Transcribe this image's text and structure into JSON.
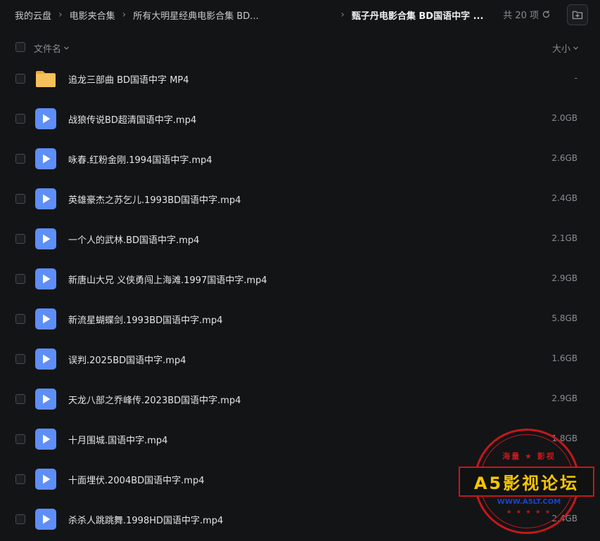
{
  "breadcrumb": {
    "items": [
      "我的云盘",
      "电影夹合集",
      "所有大明星经典电影合集 BD..."
    ],
    "current": "甄子丹电影合集 BD国语中字 ..."
  },
  "count_label": "共 20 项",
  "columns": {
    "name": "文件名",
    "size": "大小"
  },
  "files": [
    {
      "type": "folder",
      "name": "追龙三部曲 BD国语中字 MP4",
      "size": "-"
    },
    {
      "type": "video",
      "name": "战狼传说BD超清国语中字.mp4",
      "size": "2.0GB"
    },
    {
      "type": "video",
      "name": "咏春.红粉金刚.1994国语中字.mp4",
      "size": "2.6GB"
    },
    {
      "type": "video",
      "name": "英雄豪杰之苏乞儿.1993BD国语中字.mp4",
      "size": "2.4GB"
    },
    {
      "type": "video",
      "name": "一个人的武林.BD国语中字.mp4",
      "size": "2.1GB"
    },
    {
      "type": "video",
      "name": "新唐山大兄 义侠勇闯上海滩.1997国语中字.mp4",
      "size": "2.9GB"
    },
    {
      "type": "video",
      "name": "新流星蝴蝶剑.1993BD国语中字.mp4",
      "size": "5.8GB"
    },
    {
      "type": "video",
      "name": "误判.2025BD国语中字.mp4",
      "size": "1.6GB"
    },
    {
      "type": "video",
      "name": "天龙八部之乔峰传.2023BD国语中字.mp4",
      "size": "2.9GB"
    },
    {
      "type": "video",
      "name": "十月围城.国语中字.mp4",
      "size": "1.8GB"
    },
    {
      "type": "video",
      "name": "十面埋伏.2004BD国语中字.mp4",
      "size": ""
    },
    {
      "type": "video",
      "name": "杀杀人跳跳舞.1998HD国语中字.mp4",
      "size": "2.4GB"
    }
  ],
  "watermark": {
    "top": "海量 ★ 影视",
    "main": "A5影视论坛",
    "url": "WWW.A5LT.COM",
    "stars": "★ ★ ★ ★ ★"
  },
  "colors": {
    "background": "#131416",
    "folder": "#f6c15a",
    "video_icon": "#5e8ef7",
    "stamp_red": "#c4181c",
    "stamp_yellow": "#f7c600"
  }
}
